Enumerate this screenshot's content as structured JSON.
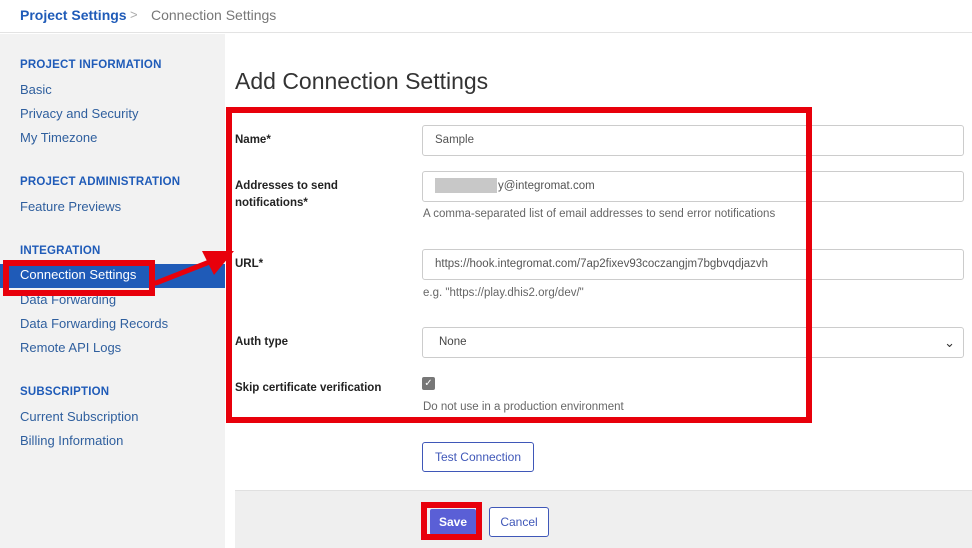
{
  "breadcrumb": {
    "root": "Project Settings",
    "separator": ">",
    "current": "Connection Settings"
  },
  "sidebar": {
    "sections": [
      {
        "heading": "PROJECT INFORMATION",
        "items": [
          "Basic",
          "Privacy and Security",
          "My Timezone"
        ]
      },
      {
        "heading": "PROJECT ADMINISTRATION",
        "items": [
          "Feature Previews"
        ]
      },
      {
        "heading": "INTEGRATION",
        "items": [
          "Connection Settings",
          "Data Forwarding",
          "Data Forwarding Records",
          "Remote API Logs"
        ]
      },
      {
        "heading": "SUBSCRIPTION",
        "items": [
          "Current Subscription",
          "Billing Information"
        ]
      }
    ],
    "active_item": "Connection Settings"
  },
  "main": {
    "title": "Add Connection Settings",
    "fields": {
      "name": {
        "label": "Name*",
        "value": "Sample"
      },
      "addresses": {
        "label_line1": "Addresses to send",
        "label_line2": "notifications*",
        "value_suffix": "y@integromat.com",
        "help": "A comma-separated list of email addresses to send error notifications"
      },
      "url": {
        "label": "URL*",
        "value": "https://hook.integromat.com/7ap2fixev93coczangjm7bgbvqdjazvh",
        "help": "e.g. \"https://play.dhis2.org/dev/\""
      },
      "auth_type": {
        "label": "Auth type",
        "selected": "None"
      },
      "skip_cert": {
        "label": "Skip certificate verification",
        "checked": true,
        "help": "Do not use in a production environment"
      }
    },
    "test_button": "Test Connection",
    "save_button": "Save",
    "cancel_button": "Cancel"
  },
  "colors": {
    "accent": "#1f5bb8",
    "annotation": "#e8000b",
    "save": "#5a5fd6"
  }
}
